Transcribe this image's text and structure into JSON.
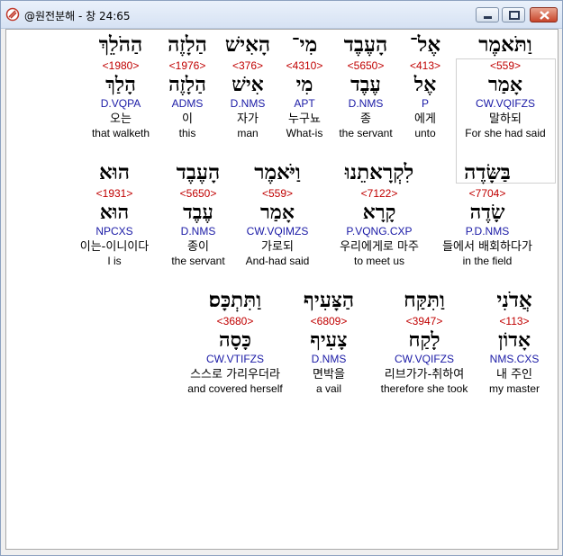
{
  "window": {
    "title": "@원전분해 - 창 24:65"
  },
  "rows": [
    {
      "words": [
        {
          "heb": "וַתֹּאמֶר",
          "strong": "<559>",
          "lemma": "אָמַר",
          "morph": "CW.VQIFZS",
          "kor": "말하되",
          "eng": "For she had said"
        },
        {
          "heb": "אֶל־",
          "strong": "<413>",
          "lemma": "אֶל",
          "morph": "P",
          "kor": "에게",
          "eng": "unto"
        },
        {
          "heb": "הָעֶבֶד",
          "strong": "<5650>",
          "lemma": "עֶבֶד",
          "morph": "D.NMS",
          "kor": "종",
          "eng": "the servant"
        },
        {
          "heb": "מִי־",
          "strong": "<4310>",
          "lemma": "מִי",
          "morph": "APT",
          "kor": "누구뇨",
          "eng": "What-is"
        },
        {
          "heb": "הָאִישׁ",
          "strong": "<376>",
          "lemma": "אִישׁ",
          "morph": "D.NMS",
          "kor": "자가",
          "eng": "man"
        },
        {
          "heb": "הַלָזֶה",
          "strong": "<1976>",
          "lemma": "הַלָזֶה",
          "morph": "ADMS",
          "kor": "이",
          "eng": "this"
        },
        {
          "heb": "הַהֹלֵךְ",
          "strong": "<1980>",
          "lemma": "הָלַךְ",
          "morph": "D.VQPA",
          "kor": "오는",
          "eng": "that walketh"
        }
      ]
    },
    {
      "words": [
        {
          "heb": "בַּשָּׂדֶה",
          "strong": "<7704>",
          "lemma": "שָׂדֶה",
          "morph": "P.D.NMS",
          "kor": "들에서 배회하다가",
          "eng": "in the field"
        },
        {
          "heb": "לִקְרָאתֵנוּ",
          "strong": "<7122>",
          "lemma": "קָרָא",
          "morph": "P.VQNG.CXP",
          "kor": "우리에게로 마주",
          "eng": "to meet us"
        },
        {
          "heb": "וַיֹּאמֶר",
          "strong": "<559>",
          "lemma": "אָמַר",
          "morph": "CW.VQIMZS",
          "kor": "가로되",
          "eng": "And-had said"
        },
        {
          "heb": "הָעֶבֶד",
          "strong": "<5650>",
          "lemma": "עֶבֶד",
          "morph": "D.NMS",
          "kor": "종이",
          "eng": "the servant"
        },
        {
          "heb": "הוּא",
          "strong": "<1931>",
          "lemma": "הוּא",
          "morph": "NPCXS",
          "kor": "이는-이니이다",
          "eng": "I is"
        }
      ]
    },
    {
      "words": [
        {
          "heb": "אֲדֹנִי",
          "strong": "<113>",
          "lemma": "אָדוֹן",
          "morph": "NMS.CXS",
          "kor": "내 주인",
          "eng": "my master"
        },
        {
          "heb": "וַתִּקַּח",
          "strong": "<3947>",
          "lemma": "לָקַח",
          "morph": "CW.VQIFZS",
          "kor": "리브가가-취하여",
          "eng": "therefore she took"
        },
        {
          "heb": "הַצָּעִיף",
          "strong": "<6809>",
          "lemma": "צָעִיף",
          "morph": "D.NMS",
          "kor": "면박을",
          "eng": "a vail"
        },
        {
          "heb": "וַתִּתְכָּס׃",
          "strong": "<3680>",
          "lemma": "כָּסָה",
          "morph": "CW.VTIFZS",
          "kor": "스스로 가리우더라",
          "eng": "and covered herself"
        }
      ]
    }
  ]
}
